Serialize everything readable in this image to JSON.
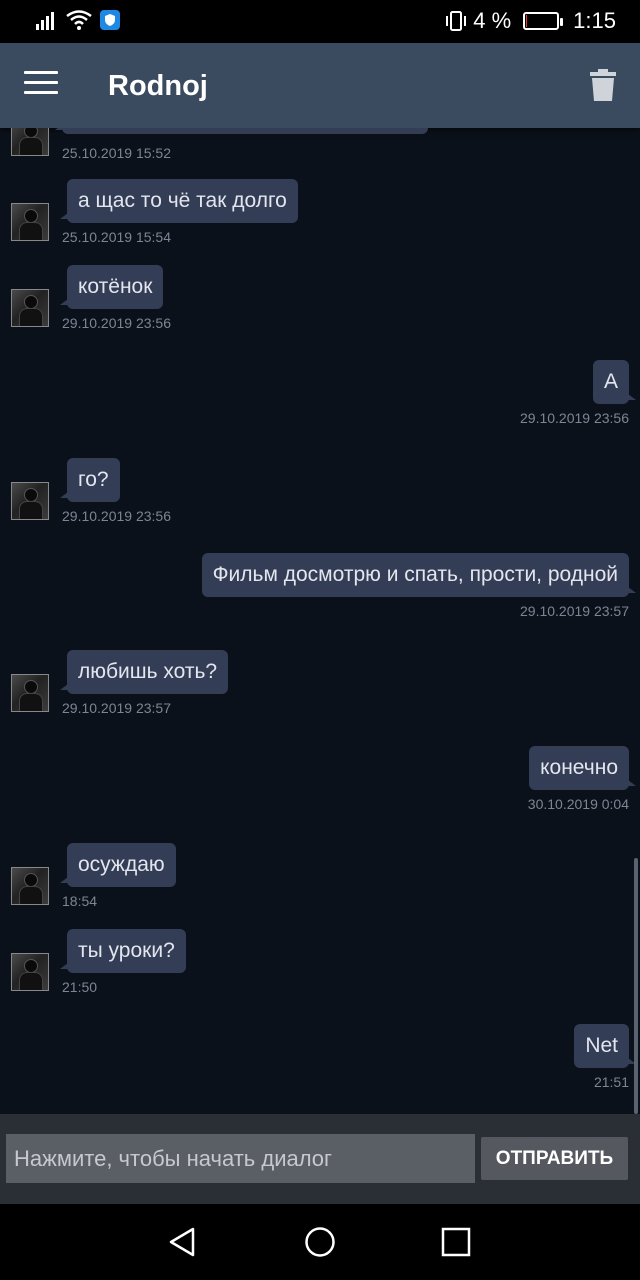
{
  "status_bar": {
    "battery_percent_text": "4 %",
    "battery_level": 0.04,
    "time": "1:15",
    "icons": [
      "signal-icon",
      "wifi-icon",
      "vpn-shield-icon",
      "vibrate-icon",
      "battery-icon"
    ]
  },
  "app_bar": {
    "title": "Rodnoj",
    "menu_icon": "hamburger-menu-icon",
    "delete_icon": "trash-icon"
  },
  "messages": [
    {
      "direction": "in",
      "text": "",
      "time": "25.10.2019 15:52"
    },
    {
      "direction": "in",
      "text": "а щас то чё так долго",
      "time": "25.10.2019 15:54"
    },
    {
      "direction": "in",
      "text": "котёнок",
      "time": "29.10.2019 23:56"
    },
    {
      "direction": "out",
      "text": "А",
      "time": "29.10.2019 23:56"
    },
    {
      "direction": "in",
      "text": "го?",
      "time": "29.10.2019 23:56"
    },
    {
      "direction": "out",
      "text": "Фильм досмотрю и спать, прости, родной",
      "time": "29.10.2019 23:57"
    },
    {
      "direction": "in",
      "text": "любишь хоть?",
      "time": "29.10.2019 23:57"
    },
    {
      "direction": "out",
      "text": "конечно",
      "time": "30.10.2019 0:04"
    },
    {
      "direction": "in",
      "text": "осуждаю",
      "time": "18:54"
    },
    {
      "direction": "in",
      "text": "ты уроки?",
      "time": "21:50"
    },
    {
      "direction": "out",
      "text": "Net",
      "time": "21:51"
    }
  ],
  "composer": {
    "placeholder": "Нажмите, чтобы начать диалог",
    "value": "",
    "send_label": "ОТПРАВИТЬ"
  },
  "nav_bar": {
    "icons": [
      "back-triangle-icon",
      "home-circle-icon",
      "recents-square-icon"
    ]
  },
  "colors": {
    "background": "#0b111a",
    "app_bar": "#3a4a5f",
    "bubble": "#333d55",
    "battery_low": "#e53935"
  }
}
